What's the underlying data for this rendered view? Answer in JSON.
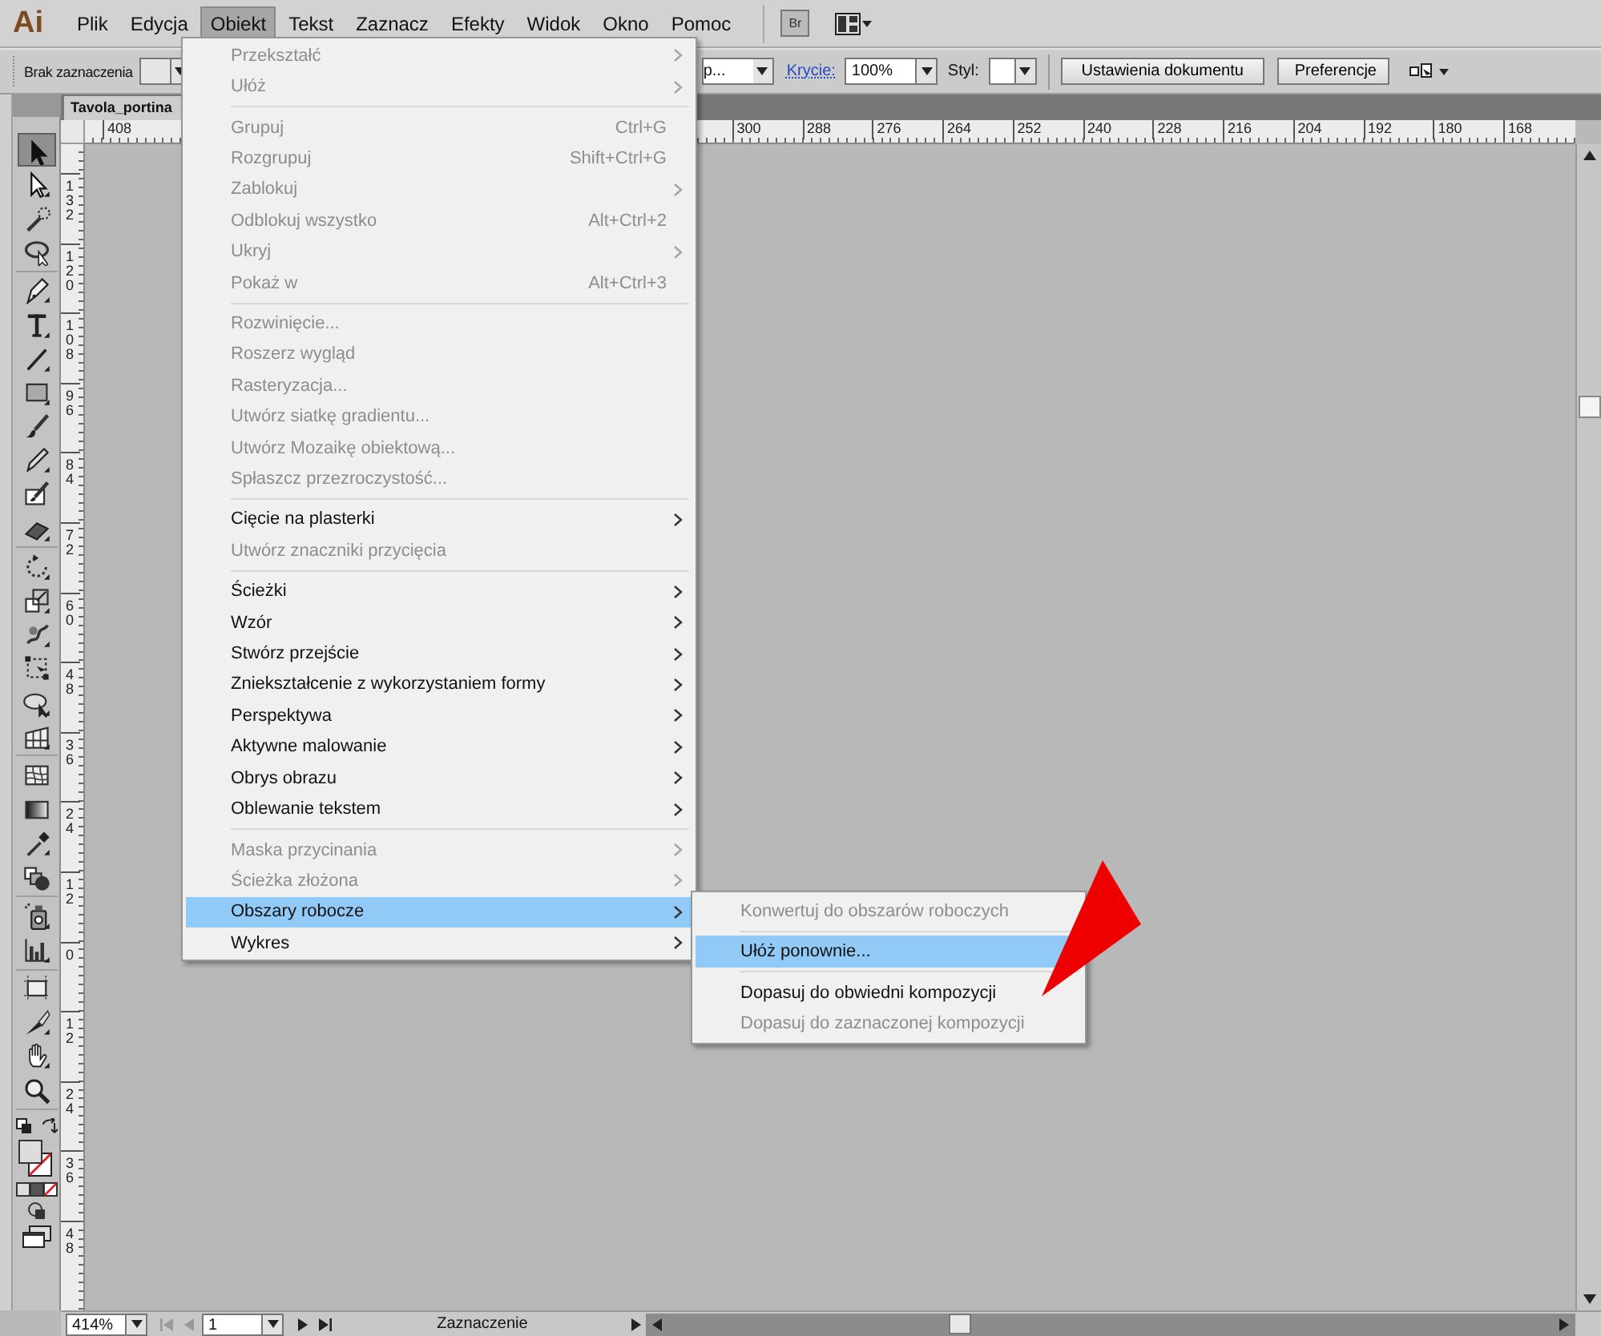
{
  "app_logo": "Ai",
  "menubar": [
    {
      "label": "Plik",
      "selected": false
    },
    {
      "label": "Edycja",
      "selected": false
    },
    {
      "label": "Obiekt",
      "selected": true
    },
    {
      "label": "Tekst",
      "selected": false
    },
    {
      "label": "Zaznacz",
      "selected": false
    },
    {
      "label": "Efekty",
      "selected": false
    },
    {
      "label": "Widok",
      "selected": false
    },
    {
      "label": "Okno",
      "selected": false
    },
    {
      "label": "Pomoc",
      "selected": false
    }
  ],
  "bridge_button": "Br",
  "control_bar": {
    "selection_label": "Brak zaznaczenia",
    "partial_field": "p...",
    "opacity_label": "Krycie:",
    "opacity_value": "100%",
    "style_label": "Styl:",
    "buttons": [
      "Ustawienia dokumentu",
      "Preferencje"
    ]
  },
  "document_tab": "Tavola_portina",
  "horizontal_ruler": [
    "408",
    "300",
    "288",
    "276",
    "264",
    "252",
    "240",
    "228",
    "216",
    "204",
    "192",
    "180",
    "168"
  ],
  "vertical_ruler": [
    "132",
    "120",
    "108",
    "96",
    "84",
    "72",
    "60",
    "48",
    "36",
    "24",
    "12",
    "0",
    "12",
    "24",
    "36",
    "48"
  ],
  "tools": [
    {
      "kind": "selection",
      "selected": true
    },
    {
      "kind": "direct-selection",
      "selected": false
    },
    {
      "kind": "wand",
      "selected": false
    },
    {
      "kind": "lasso",
      "selected": false
    },
    {
      "kind": "separator"
    },
    {
      "kind": "pen",
      "selected": false
    },
    {
      "kind": "type",
      "selected": false
    },
    {
      "kind": "line",
      "selected": false
    },
    {
      "kind": "rectangle",
      "selected": false
    },
    {
      "kind": "brush",
      "selected": false
    },
    {
      "kind": "pencil",
      "selected": false
    },
    {
      "kind": "blob-brush",
      "selected": false
    },
    {
      "kind": "eraser",
      "selected": false
    },
    {
      "kind": "separator"
    },
    {
      "kind": "rotate",
      "selected": false
    },
    {
      "kind": "scale",
      "selected": false
    },
    {
      "kind": "warp",
      "selected": false
    },
    {
      "kind": "free-transform",
      "selected": false
    },
    {
      "kind": "shape-builder",
      "selected": false
    },
    {
      "kind": "perspective",
      "selected": false
    },
    {
      "kind": "separator"
    },
    {
      "kind": "mesh",
      "selected": false
    },
    {
      "kind": "gradient",
      "selected": false
    },
    {
      "kind": "eyedropper",
      "selected": false
    },
    {
      "kind": "blend",
      "selected": false
    },
    {
      "kind": "separator"
    },
    {
      "kind": "sprayer",
      "selected": false
    },
    {
      "kind": "graph",
      "selected": false
    },
    {
      "kind": "separator"
    },
    {
      "kind": "artboard",
      "selected": false
    },
    {
      "kind": "slice",
      "selected": false
    },
    {
      "kind": "hand",
      "selected": false
    },
    {
      "kind": "zoom",
      "selected": false
    }
  ],
  "menu": {
    "items": [
      {
        "kind": "item",
        "label": "Przekształć",
        "submenu": true,
        "disabled": true,
        "selected": false
      },
      {
        "kind": "item",
        "label": "Ułóż",
        "submenu": true,
        "disabled": true,
        "selected": false
      },
      {
        "kind": "separator"
      },
      {
        "kind": "item",
        "label": "Grupuj",
        "shortcut": "Ctrl+G",
        "submenu": false,
        "disabled": true,
        "selected": false
      },
      {
        "kind": "item",
        "label": "Rozgrupuj",
        "shortcut": "Shift+Ctrl+G",
        "submenu": false,
        "disabled": true,
        "selected": false
      },
      {
        "kind": "item",
        "label": "Zablokuj",
        "submenu": true,
        "disabled": true,
        "selected": false
      },
      {
        "kind": "item",
        "label": "Odblokuj wszystko",
        "shortcut": "Alt+Ctrl+2",
        "submenu": false,
        "disabled": true,
        "selected": false
      },
      {
        "kind": "item",
        "label": "Ukryj",
        "submenu": true,
        "disabled": true,
        "selected": false
      },
      {
        "kind": "item",
        "label": "Pokaż w",
        "shortcut": "Alt+Ctrl+3",
        "submenu": false,
        "disabled": true,
        "selected": false
      },
      {
        "kind": "separator"
      },
      {
        "kind": "item",
        "label": "Rozwinięcie...",
        "submenu": false,
        "disabled": true,
        "selected": false
      },
      {
        "kind": "item",
        "label": "Roszerz wygląd",
        "submenu": false,
        "disabled": true,
        "selected": false
      },
      {
        "kind": "item",
        "label": "Rasteryzacja...",
        "submenu": false,
        "disabled": true,
        "selected": false
      },
      {
        "kind": "item",
        "label": "Utwórz siatkę gradientu...",
        "submenu": false,
        "disabled": true,
        "selected": false
      },
      {
        "kind": "item",
        "label": "Utwórz Mozaikę obiektową...",
        "submenu": false,
        "disabled": true,
        "selected": false
      },
      {
        "kind": "item",
        "label": "Spłaszcz przezroczystość...",
        "submenu": false,
        "disabled": true,
        "selected": false
      },
      {
        "kind": "separator"
      },
      {
        "kind": "item",
        "label": "Cięcie na plasterki",
        "submenu": true,
        "disabled": false,
        "selected": false
      },
      {
        "kind": "item",
        "label": "Utwórz znaczniki przycięcia",
        "submenu": false,
        "disabled": true,
        "selected": false
      },
      {
        "kind": "separator"
      },
      {
        "kind": "item",
        "label": "Ścieżki",
        "submenu": true,
        "disabled": false,
        "selected": false
      },
      {
        "kind": "item",
        "label": "Wzór",
        "submenu": true,
        "disabled": false,
        "selected": false
      },
      {
        "kind": "item",
        "label": "Stwórz przejście",
        "submenu": true,
        "disabled": false,
        "selected": false
      },
      {
        "kind": "item",
        "label": "Zniekształcenie z wykorzystaniem formy",
        "submenu": true,
        "disabled": false,
        "selected": false
      },
      {
        "kind": "item",
        "label": "Perspektywa",
        "submenu": true,
        "disabled": false,
        "selected": false
      },
      {
        "kind": "item",
        "label": "Aktywne malowanie",
        "submenu": true,
        "disabled": false,
        "selected": false
      },
      {
        "kind": "item",
        "label": "Obrys obrazu",
        "submenu": true,
        "disabled": false,
        "selected": false
      },
      {
        "kind": "item",
        "label": "Oblewanie tekstem",
        "submenu": true,
        "disabled": false,
        "selected": false
      },
      {
        "kind": "separator"
      },
      {
        "kind": "item",
        "label": "Maska przycinania",
        "submenu": true,
        "disabled": true,
        "selected": false
      },
      {
        "kind": "item",
        "label": "Ścieżka złożona",
        "submenu": true,
        "disabled": true,
        "selected": false
      },
      {
        "kind": "item",
        "label": "Obszary robocze",
        "submenu": true,
        "disabled": false,
        "selected": true
      },
      {
        "kind": "item",
        "label": "Wykres",
        "submenu": true,
        "disabled": false,
        "selected": false
      }
    ]
  },
  "submenu": {
    "items": [
      {
        "kind": "item",
        "label": "Konwertuj do obszarów roboczych",
        "disabled": true,
        "selected": false
      },
      {
        "kind": "separator"
      },
      {
        "kind": "item",
        "label": "Ułóż ponownie...",
        "disabled": false,
        "selected": true
      },
      {
        "kind": "separator"
      },
      {
        "kind": "item",
        "label": "Dopasuj do obwiedni kompozycji",
        "disabled": false,
        "selected": false
      },
      {
        "kind": "item",
        "label": "Dopasuj do zaznaczonej kompozycji",
        "disabled": true,
        "selected": false
      }
    ]
  },
  "status_bar": {
    "zoom": "414%",
    "artboard": "1",
    "mode": "Zaznaczenie"
  }
}
